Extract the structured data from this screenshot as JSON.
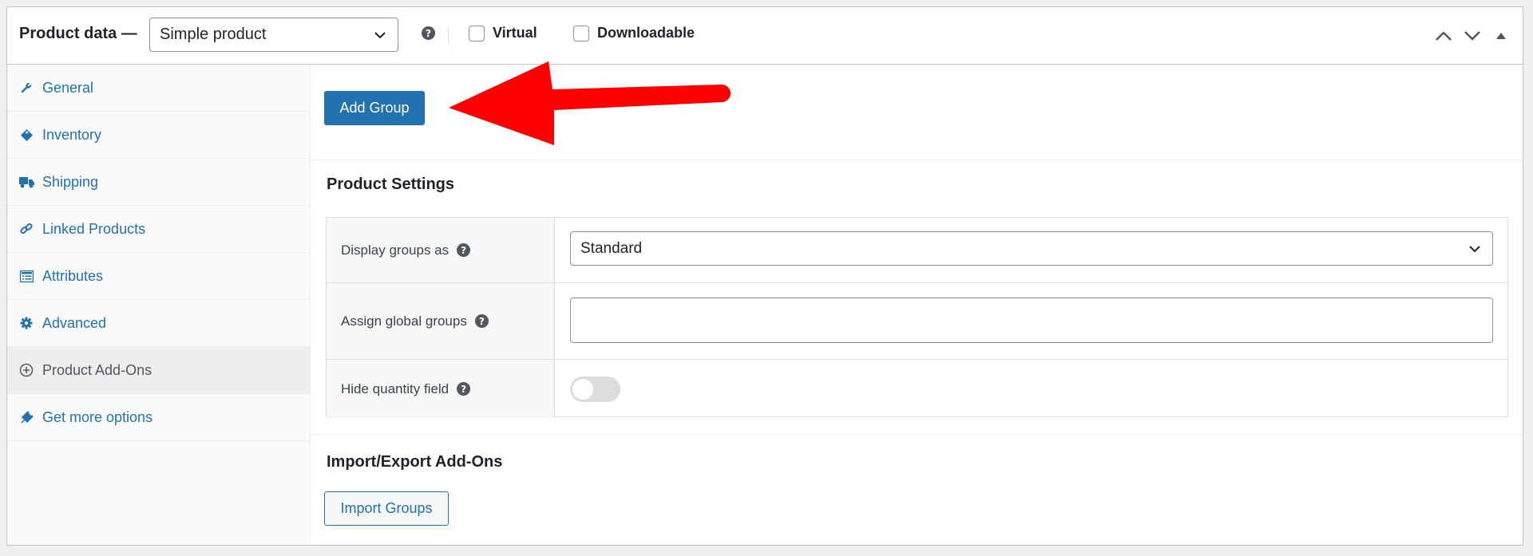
{
  "header": {
    "title": "Product data —",
    "product_type": "Simple product",
    "virtual_label": "Virtual",
    "downloadable_label": "Downloadable"
  },
  "sidebar": {
    "items": [
      {
        "label": "General",
        "icon": "wrench-icon"
      },
      {
        "label": "Inventory",
        "icon": "tag-icon"
      },
      {
        "label": "Shipping",
        "icon": "truck-icon"
      },
      {
        "label": "Linked Products",
        "icon": "link-icon"
      },
      {
        "label": "Attributes",
        "icon": "list-icon"
      },
      {
        "label": "Advanced",
        "icon": "gear-icon"
      },
      {
        "label": "Product Add-Ons",
        "icon": "plus-circle-icon",
        "active": true
      },
      {
        "label": "Get more options",
        "icon": "plugin-icon"
      }
    ]
  },
  "main": {
    "add_group_label": "Add Group",
    "product_settings_title": "Product Settings",
    "settings": {
      "display_groups_label": "Display groups as",
      "display_groups_value": "Standard",
      "assign_global_label": "Assign global groups",
      "assign_global_value": "",
      "hide_quantity_label": "Hide quantity field",
      "hide_quantity_enabled": false
    },
    "import_export_title": "Import/Export Add-Ons",
    "import_groups_label": "Import Groups"
  },
  "colors": {
    "accent": "#2271b1",
    "annotation_arrow": "#ff0000"
  }
}
